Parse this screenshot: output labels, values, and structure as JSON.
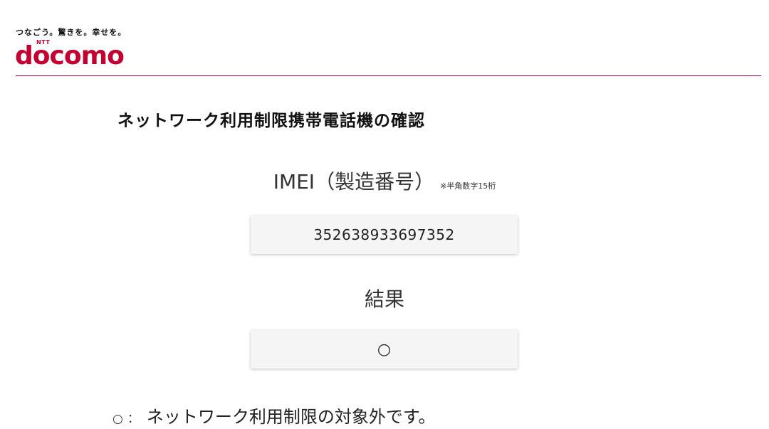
{
  "header": {
    "tagline": "つなごう。驚きを。幸せを。",
    "logo_ntt": "NTT",
    "logo_word": "docomo",
    "brand_color": "#c3002f"
  },
  "main": {
    "title": "ネットワーク利用制限携帯電話機の確認",
    "imei_label": "IMEI（製造番号）",
    "imei_note": "※半角数字15桁",
    "imei_value": "352638933697352",
    "result_label": "結果",
    "result_value": "○"
  },
  "legend": {
    "symbol": "○",
    "colon": "：",
    "text": "ネットワーク利用制限の対象外です。"
  }
}
